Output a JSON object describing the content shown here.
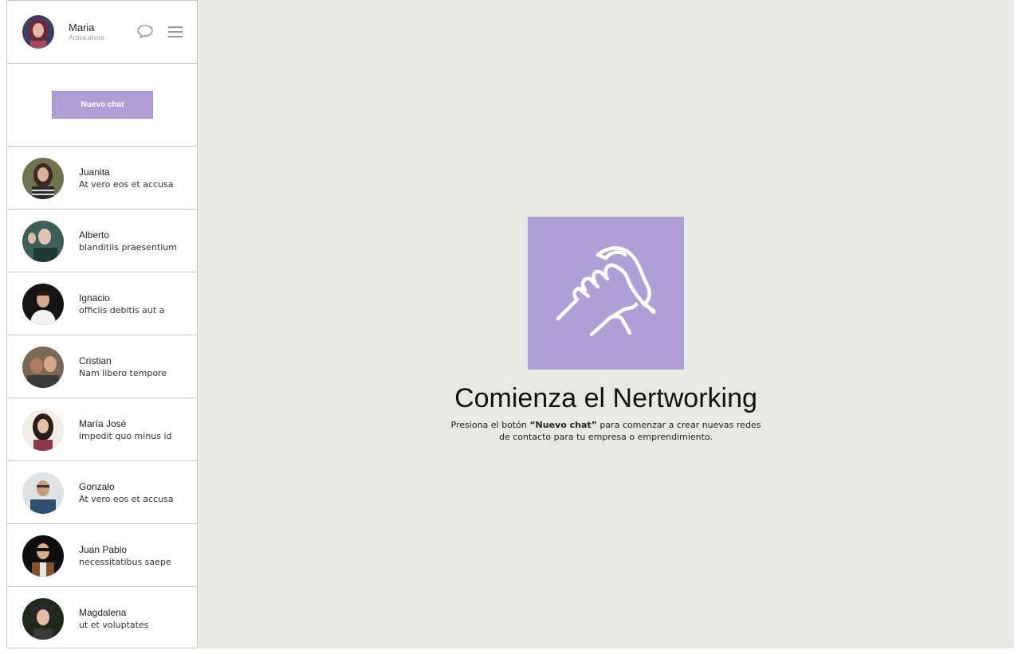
{
  "profile": {
    "name": "Maria",
    "status": "Activa ahora",
    "icons": [
      "chat-bubble-icon",
      "hamburger-menu-icon"
    ]
  },
  "new_chat": {
    "label": "Nuevo chat"
  },
  "contacts": [
    {
      "name": "Juanita",
      "message": "At vero eos et accusa"
    },
    {
      "name": "Alberto",
      "message": "blanditiis praesentium"
    },
    {
      "name": "Ignacio",
      "message": "officiis debitis aut a"
    },
    {
      "name": "Cristian",
      "message": "Nam libero tempore"
    },
    {
      "name": "María José",
      "message": "impedit quo minus id"
    },
    {
      "name": "Gonzalo",
      "message": "At vero eos et accusa"
    },
    {
      "name": "Juan Pablo",
      "message": "necessitatibus saepe"
    },
    {
      "name": "Magdalena",
      "message": "ut et voluptates"
    }
  ],
  "hero": {
    "icon": "handshake-icon",
    "title": "Comienza el Nertworking",
    "text_before": "Presiona el botón ",
    "text_bold": "“Nuevo chat”",
    "text_after": " para comenzar a crear nuevas redes de contacto para tu empresa o emprendimiento."
  },
  "colors": {
    "accent": "#b09fd7",
    "main_background": "#e7e9e2",
    "border": "#c8c8c8"
  }
}
